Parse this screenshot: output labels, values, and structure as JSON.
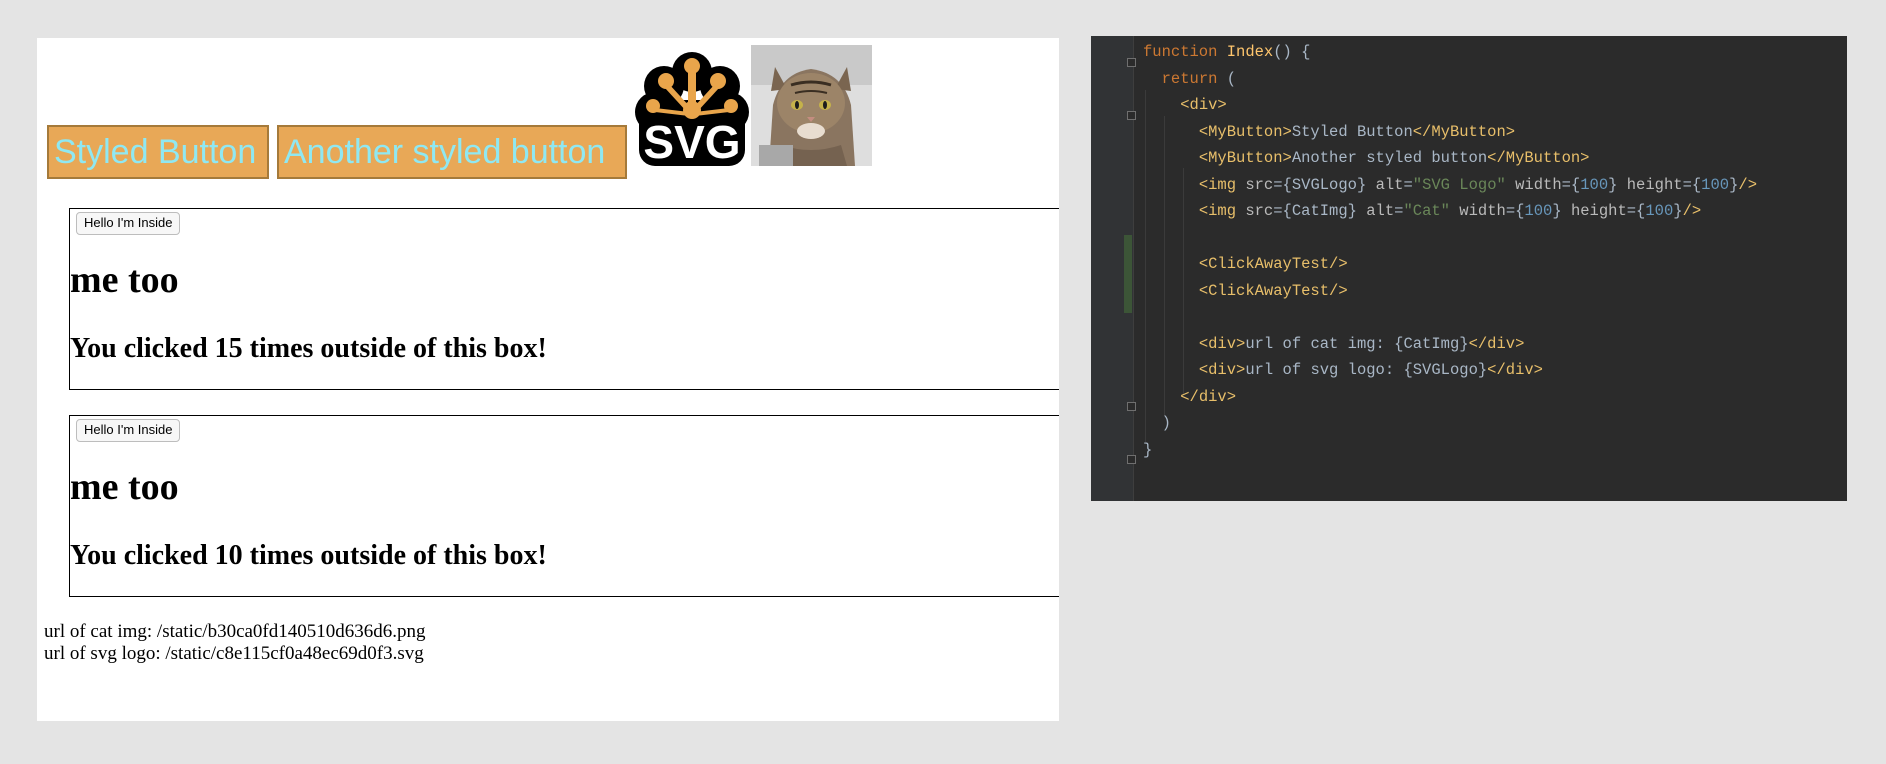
{
  "preview": {
    "button1_label": "Styled Button",
    "button2_label": "Another styled button",
    "svg_logo_text": "SVG",
    "boxes": [
      {
        "inside_button": "Hello I'm Inside",
        "heading": "me too",
        "clicked_text": "You clicked 15 times outside of this box!"
      },
      {
        "inside_button": "Hello I'm Inside",
        "heading": "me too",
        "clicked_text": "You clicked 10 times outside of this box!"
      }
    ],
    "url_cat": "url of cat img: /static/b30ca0fd140510d636d6.png",
    "url_svg": "url of svg logo: /static/c8e115cf0a48ec69d0f3.svg"
  },
  "editor": {
    "lines": [
      {
        "tokens": [
          {
            "t": "kw",
            "v": "function "
          },
          {
            "t": "fn",
            "v": "Index"
          },
          {
            "t": "txt",
            "v": "() {"
          }
        ]
      },
      {
        "tokens": [
          {
            "t": "txt",
            "v": "  "
          },
          {
            "t": "kw",
            "v": "return"
          },
          {
            "t": "txt",
            "v": " ("
          }
        ]
      },
      {
        "tokens": [
          {
            "t": "txt",
            "v": "    "
          },
          {
            "t": "tag",
            "v": "<div>"
          }
        ]
      },
      {
        "tokens": [
          {
            "t": "txt",
            "v": "      "
          },
          {
            "t": "tag",
            "v": "<MyButton>"
          },
          {
            "t": "txt",
            "v": "Styled Button"
          },
          {
            "t": "tag",
            "v": "</MyButton>"
          }
        ]
      },
      {
        "tokens": [
          {
            "t": "txt",
            "v": "      "
          },
          {
            "t": "tag",
            "v": "<MyButton>"
          },
          {
            "t": "txt",
            "v": "Another styled button"
          },
          {
            "t": "tag",
            "v": "</MyButton>"
          }
        ]
      },
      {
        "tokens": [
          {
            "t": "txt",
            "v": "      "
          },
          {
            "t": "tag",
            "v": "<img "
          },
          {
            "t": "attr",
            "v": "src"
          },
          {
            "t": "txt",
            "v": "={SVGLogo} "
          },
          {
            "t": "attr",
            "v": "alt"
          },
          {
            "t": "txt",
            "v": "="
          },
          {
            "t": "str",
            "v": "\"SVG Logo\""
          },
          {
            "t": "txt",
            "v": " "
          },
          {
            "t": "attr",
            "v": "width"
          },
          {
            "t": "txt",
            "v": "={"
          },
          {
            "t": "num",
            "v": "100"
          },
          {
            "t": "txt",
            "v": "} "
          },
          {
            "t": "attr",
            "v": "height"
          },
          {
            "t": "txt",
            "v": "={"
          },
          {
            "t": "num",
            "v": "100"
          },
          {
            "t": "txt",
            "v": "}"
          },
          {
            "t": "tag",
            "v": "/>"
          }
        ]
      },
      {
        "tokens": [
          {
            "t": "txt",
            "v": "      "
          },
          {
            "t": "tag",
            "v": "<img "
          },
          {
            "t": "attr",
            "v": "src"
          },
          {
            "t": "txt",
            "v": "={CatImg} "
          },
          {
            "t": "attr",
            "v": "alt"
          },
          {
            "t": "txt",
            "v": "="
          },
          {
            "t": "str",
            "v": "\"Cat\""
          },
          {
            "t": "txt",
            "v": " "
          },
          {
            "t": "attr",
            "v": "width"
          },
          {
            "t": "txt",
            "v": "={"
          },
          {
            "t": "num",
            "v": "100"
          },
          {
            "t": "txt",
            "v": "} "
          },
          {
            "t": "attr",
            "v": "height"
          },
          {
            "t": "txt",
            "v": "={"
          },
          {
            "t": "num",
            "v": "100"
          },
          {
            "t": "txt",
            "v": "}"
          },
          {
            "t": "tag",
            "v": "/>"
          }
        ]
      },
      {
        "tokens": []
      },
      {
        "tokens": [
          {
            "t": "txt",
            "v": "      "
          },
          {
            "t": "tag",
            "v": "<ClickAwayTest/>"
          }
        ]
      },
      {
        "tokens": [
          {
            "t": "txt",
            "v": "      "
          },
          {
            "t": "tag",
            "v": "<ClickAwayTest/>"
          }
        ]
      },
      {
        "tokens": []
      },
      {
        "tokens": [
          {
            "t": "txt",
            "v": "      "
          },
          {
            "t": "tag",
            "v": "<div>"
          },
          {
            "t": "txt",
            "v": "url of cat img: {CatImg}"
          },
          {
            "t": "tag",
            "v": "</div>"
          }
        ]
      },
      {
        "tokens": [
          {
            "t": "txt",
            "v": "      "
          },
          {
            "t": "tag",
            "v": "<div>"
          },
          {
            "t": "txt",
            "v": "url of svg logo: {SVGLogo}"
          },
          {
            "t": "tag",
            "v": "</div>"
          }
        ]
      },
      {
        "tokens": [
          {
            "t": "txt",
            "v": "    "
          },
          {
            "t": "tag",
            "v": "</div>"
          }
        ]
      },
      {
        "tokens": [
          {
            "t": "txt",
            "v": "  )"
          }
        ]
      },
      {
        "tokens": [
          {
            "t": "txt",
            "v": "}"
          }
        ]
      }
    ]
  },
  "colors": {
    "page_background": "#e4e4e4",
    "button_background": "#e8a857",
    "button_text": "#8fe8f2",
    "editor_background": "#2b2b2b",
    "svg_logo_orange": "#e9a54b"
  },
  "icons": [
    "svg-logo-image",
    "cat-photo-image",
    "fold-marker-icon"
  ]
}
